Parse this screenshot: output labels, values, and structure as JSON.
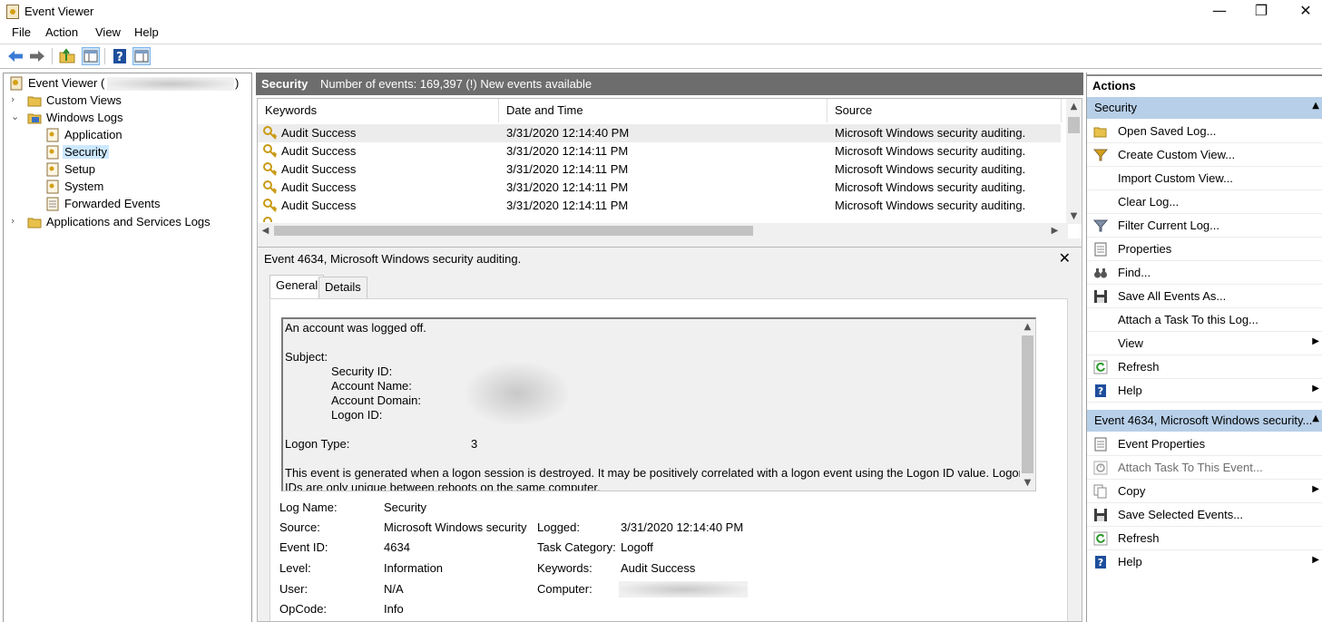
{
  "window": {
    "title": "Event Viewer",
    "minimize": "—",
    "maximize": "❐",
    "close": "✕"
  },
  "menu": [
    "File",
    "Action",
    "View",
    "Help"
  ],
  "toolbar": [
    "back-arrow-icon",
    "forward-arrow-icon",
    "folder-up-icon",
    "show-hide-tree-icon",
    "help-icon",
    "show-hide-action-pane-icon"
  ],
  "tree": {
    "root": "Event Viewer (",
    "root_suffix": ")",
    "custom_views": "Custom Views",
    "windows_logs": "Windows Logs",
    "application": "Application",
    "security": "Security",
    "setup": "Setup",
    "system": "System",
    "forwarded_events": "Forwarded Events",
    "apps_services": "Applications and Services Logs"
  },
  "log_header": {
    "name": "Security",
    "summary": "Number of events: 169,397 (!) New events available"
  },
  "grid": {
    "columns": [
      "Keywords",
      "Date and Time",
      "Source"
    ],
    "rows": [
      {
        "keywords": "Audit Success",
        "date": "3/31/2020 12:14:40 PM",
        "source": "Microsoft Windows security auditing."
      },
      {
        "keywords": "Audit Success",
        "date": "3/31/2020 12:14:11 PM",
        "source": "Microsoft Windows security auditing."
      },
      {
        "keywords": "Audit Success",
        "date": "3/31/2020 12:14:11 PM",
        "source": "Microsoft Windows security auditing."
      },
      {
        "keywords": "Audit Success",
        "date": "3/31/2020 12:14:11 PM",
        "source": "Microsoft Windows security auditing."
      },
      {
        "keywords": "Audit Success",
        "date": "3/31/2020 12:14:11 PM",
        "source": "Microsoft Windows security auditing."
      }
    ]
  },
  "detail": {
    "title": "Event 4634, Microsoft Windows security auditing.",
    "close": "✕",
    "tabs": [
      "General",
      "Details"
    ],
    "message": {
      "line1": "An account was logged off.",
      "subject": "Subject:",
      "security_id": "Security ID:",
      "account_name": "Account Name:",
      "account_domain": "Account Domain:",
      "logon_id": "Logon ID:",
      "logon_type_label": "Logon Type:",
      "logon_type_value": "3",
      "description1": "This event is generated when a logon session is destroyed. It may be positively correlated with a logon event using the Logon ID value. Logon",
      "description2": "IDs are only unique between reboots on the same computer."
    },
    "props": {
      "log_name_label": "Log Name:",
      "log_name": "Security",
      "source_label": "Source:",
      "source": "Microsoft Windows security",
      "logged_label": "Logged:",
      "logged": "3/31/2020 12:14:40 PM",
      "event_id_label": "Event ID:",
      "event_id": "4634",
      "task_category_label": "Task Category:",
      "task_category": "Logoff",
      "level_label": "Level:",
      "level": "Information",
      "keywords_label": "Keywords:",
      "keywords": "Audit Success",
      "user_label": "User:",
      "user": "N/A",
      "computer_label": "Computer:",
      "opcode_label": "OpCode:",
      "opcode": "Info"
    }
  },
  "actions": {
    "header": "Actions",
    "section1": "Security",
    "items1": [
      {
        "label": "Open Saved Log...",
        "icon": "open-folder-icon"
      },
      {
        "label": "Create Custom View...",
        "icon": "filter-icon"
      },
      {
        "label": "Import Custom View...",
        "icon": ""
      },
      {
        "label": "Clear Log...",
        "icon": ""
      },
      {
        "label": "Filter Current Log...",
        "icon": "filter-icon"
      },
      {
        "label": "Properties",
        "icon": "properties-icon"
      },
      {
        "label": "Find...",
        "icon": "binoculars-icon"
      },
      {
        "label": "Save All Events As...",
        "icon": "save-icon"
      },
      {
        "label": "Attach a Task To this Log...",
        "icon": ""
      },
      {
        "label": "View",
        "icon": ""
      },
      {
        "label": "Refresh",
        "icon": "refresh-icon"
      },
      {
        "label": "Help",
        "icon": "help-icon"
      }
    ],
    "section2": "Event 4634, Microsoft Windows security...",
    "items2": [
      {
        "label": "Event Properties",
        "icon": "properties-icon"
      },
      {
        "label": "Attach Task To This Event...",
        "icon": "task-icon"
      },
      {
        "label": "Copy",
        "icon": "copy-icon"
      },
      {
        "label": "Save Selected Events...",
        "icon": "save-icon"
      },
      {
        "label": "Refresh",
        "icon": "refresh-icon"
      },
      {
        "label": "Help",
        "icon": "help-icon"
      }
    ]
  },
  "colors": {
    "header_gray": "#6d6d6d",
    "selection": "#cce8ff",
    "section_blue": "#b7cfe8",
    "help_blue": "#1e4e9c"
  }
}
